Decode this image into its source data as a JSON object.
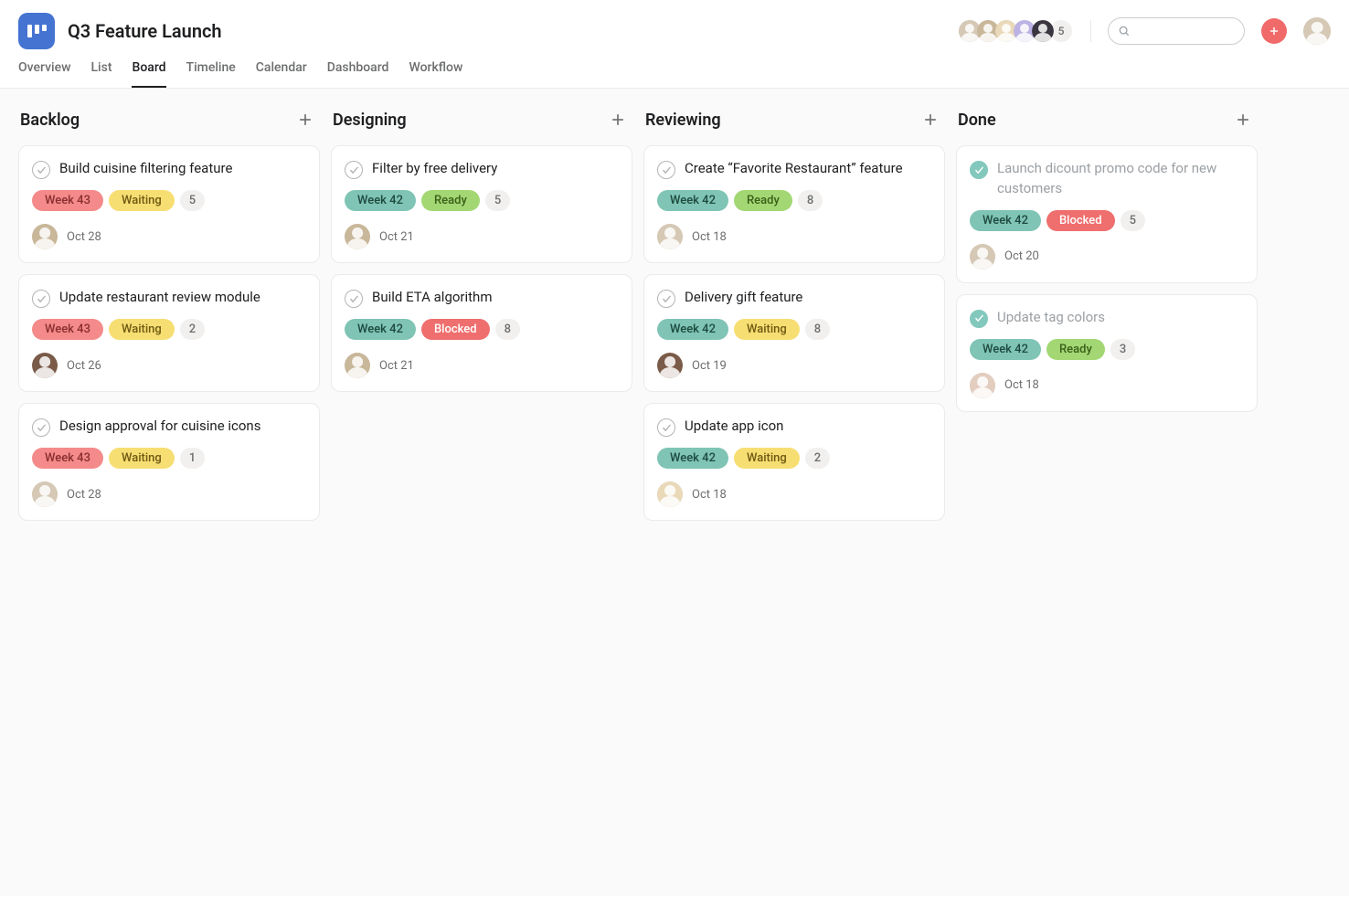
{
  "project": {
    "title": "Q3 Feature Launch",
    "member_overflow": "5"
  },
  "search": {
    "placeholder": ""
  },
  "tabs": [
    {
      "label": "Overview",
      "active": false
    },
    {
      "label": "List",
      "active": false
    },
    {
      "label": "Board",
      "active": true
    },
    {
      "label": "Timeline",
      "active": false
    },
    {
      "label": "Calendar",
      "active": false
    },
    {
      "label": "Dashboard",
      "active": false
    },
    {
      "label": "Workflow",
      "active": false
    }
  ],
  "avatar_colors": [
    "#d5c8b5",
    "#c9b79a",
    "#e9d9b8",
    "#bcb2e3",
    "#3a3640"
  ],
  "columns": [
    {
      "title": "Backlog",
      "cards": [
        {
          "title": "Build cuisine filtering feature",
          "done": false,
          "tags": [
            {
              "text": "Week 43",
              "style": "red"
            },
            {
              "text": "Waiting",
              "style": "yellow"
            }
          ],
          "count": "5",
          "date": "Oct 28",
          "avatar": "#c9b79a"
        },
        {
          "title": "Update restaurant review module",
          "done": false,
          "tags": [
            {
              "text": "Week 43",
              "style": "red"
            },
            {
              "text": "Waiting",
              "style": "yellow"
            }
          ],
          "count": "2",
          "date": "Oct 26",
          "avatar": "#7a5a48"
        },
        {
          "title": "Design approval for cuisine icons",
          "done": false,
          "tags": [
            {
              "text": "Week 43",
              "style": "red"
            },
            {
              "text": "Waiting",
              "style": "yellow"
            }
          ],
          "count": "1",
          "date": "Oct 28",
          "avatar": "#d5c8b5"
        }
      ]
    },
    {
      "title": "Designing",
      "cards": [
        {
          "title": "Filter by free delivery",
          "done": false,
          "tags": [
            {
              "text": "Week 42",
              "style": "teal"
            },
            {
              "text": "Ready",
              "style": "green"
            }
          ],
          "count": "5",
          "date": "Oct 21",
          "avatar": "#c9b79a"
        },
        {
          "title": "Build ETA algorithm",
          "done": false,
          "tags": [
            {
              "text": "Week 42",
              "style": "teal"
            },
            {
              "text": "Blocked",
              "style": "redsolid"
            }
          ],
          "count": "8",
          "date": "Oct 21",
          "avatar": "#c9b79a"
        }
      ]
    },
    {
      "title": "Reviewing",
      "cards": [
        {
          "title": "Create “Favorite Restaurant” feature",
          "done": false,
          "tags": [
            {
              "text": "Week 42",
              "style": "teal"
            },
            {
              "text": "Ready",
              "style": "green"
            }
          ],
          "count": "8",
          "date": "Oct 18",
          "avatar": "#d5c8b5"
        },
        {
          "title": "Delivery gift feature",
          "done": false,
          "tags": [
            {
              "text": "Week 42",
              "style": "teal"
            },
            {
              "text": "Waiting",
              "style": "yellow"
            }
          ],
          "count": "8",
          "date": "Oct 19",
          "avatar": "#7a5a48"
        },
        {
          "title": "Update app icon",
          "done": false,
          "tags": [
            {
              "text": "Week 42",
              "style": "teal"
            },
            {
              "text": "Waiting",
              "style": "yellow"
            }
          ],
          "count": "2",
          "date": "Oct 18",
          "avatar": "#e9d9b8"
        }
      ]
    },
    {
      "title": "Done",
      "cards": [
        {
          "title": "Launch dicount promo code for new customers",
          "done": true,
          "tags": [
            {
              "text": "Week 42",
              "style": "teal"
            },
            {
              "text": "Blocked",
              "style": "redsolid"
            }
          ],
          "count": "5",
          "date": "Oct 20",
          "avatar": "#d5c8b5"
        },
        {
          "title": "Update tag colors",
          "done": true,
          "tags": [
            {
              "text": "Week 42",
              "style": "teal"
            },
            {
              "text": "Ready",
              "style": "green"
            }
          ],
          "count": "3",
          "date": "Oct 18",
          "avatar": "#e3cdbf"
        }
      ]
    }
  ]
}
